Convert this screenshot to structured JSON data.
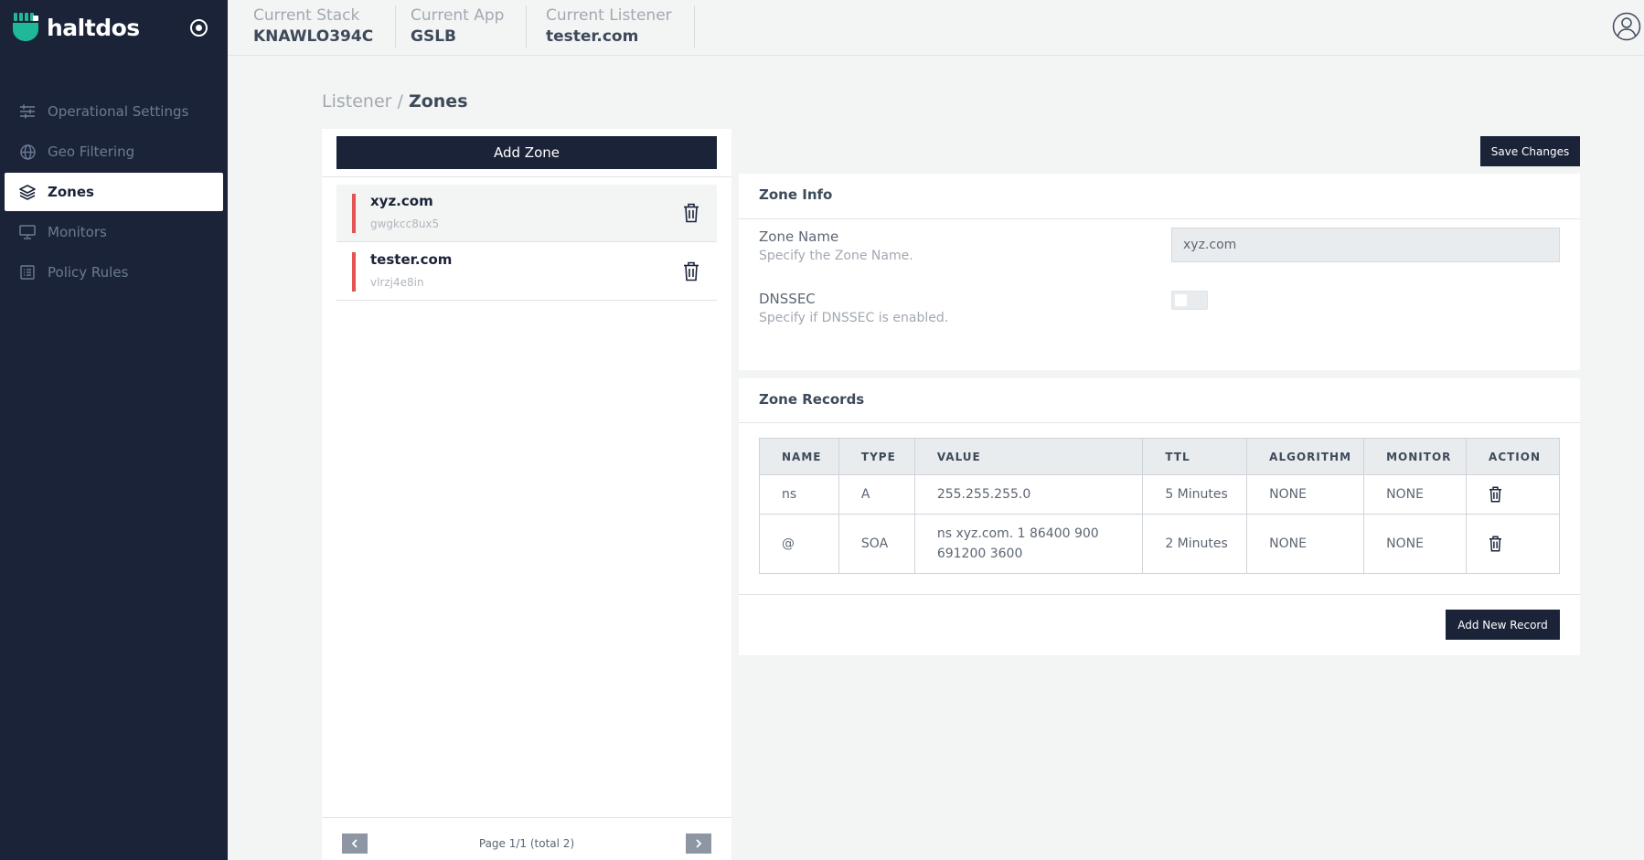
{
  "app": {
    "brand": "haltdos"
  },
  "sidebar": {
    "items": [
      {
        "label": "Operational Settings",
        "icon": "sliders-icon"
      },
      {
        "label": "Geo Filtering",
        "icon": "globe-icon"
      },
      {
        "label": "Zones",
        "icon": "layers-icon",
        "active": true
      },
      {
        "label": "Monitors",
        "icon": "monitor-icon"
      },
      {
        "label": "Policy Rules",
        "icon": "list-icon"
      }
    ]
  },
  "header": {
    "stack_label": "Current Stack",
    "stack_value": "KNAWLO394C",
    "app_label": "Current App",
    "app_value": "GSLB",
    "listener_label": "Current Listener",
    "listener_value": "tester.com"
  },
  "breadcrumb": {
    "parent": "Listener",
    "separator": "/",
    "current": "Zones"
  },
  "zones": {
    "add_label": "Add Zone",
    "items": [
      {
        "name": "xyz.com",
        "id": "gwgkcc8ux5",
        "selected": true
      },
      {
        "name": "tester.com",
        "id": "vlrzj4e8in",
        "selected": false
      }
    ],
    "pager": "Page 1/1 (total 2)"
  },
  "save_label": "Save Changes",
  "zone_info": {
    "title": "Zone Info",
    "name_label": "Zone Name",
    "name_help": "Specify the Zone Name.",
    "name_value": "xyz.com",
    "dnssec_label": "DNSSEC",
    "dnssec_help": "Specify if DNSSEC is enabled.",
    "dnssec_enabled": false
  },
  "zone_records": {
    "title": "Zone Records",
    "columns": [
      "NAME",
      "TYPE",
      "VALUE",
      "TTL",
      "ALGORITHM",
      "MONITOR",
      "ACTION"
    ],
    "rows": [
      {
        "name": "ns",
        "type": "A",
        "value": "255.255.255.0",
        "ttl": "5 Minutes",
        "algorithm": "NONE",
        "monitor": "NONE"
      },
      {
        "name": "@",
        "type": "SOA",
        "value_line1": "ns xyz.com. 1 86400 900",
        "value_line2": "691200 3600",
        "ttl": "2 Minutes",
        "algorithm": "NONE",
        "monitor": "NONE"
      }
    ],
    "add_label": "Add New Record"
  },
  "colors": {
    "sidebar": "#1b2339",
    "accent": "#1fb99a",
    "zone_marker": "#e55353"
  }
}
